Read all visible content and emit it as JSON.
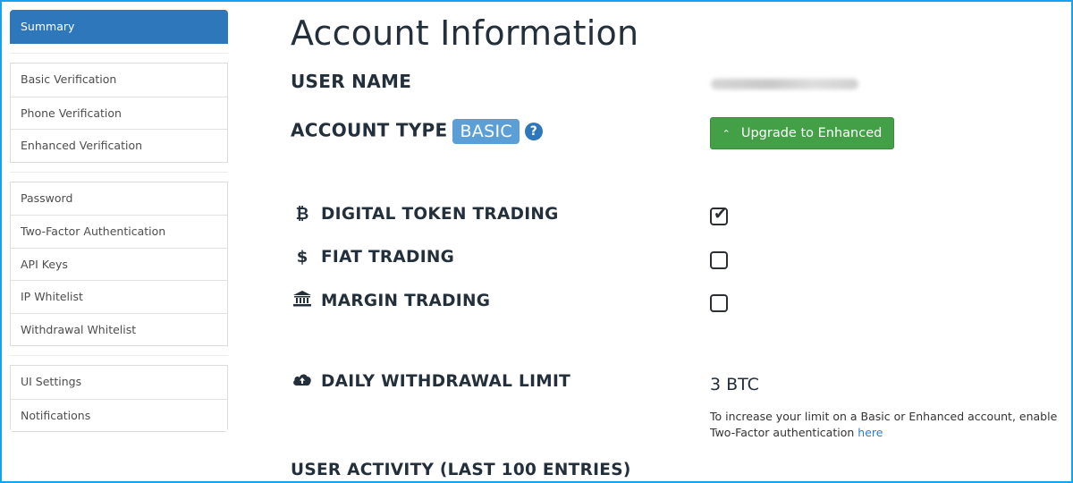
{
  "sidebar": {
    "active": {
      "label": "Summary",
      "color": "#2e77bb"
    },
    "groups": [
      {
        "items": [
          {
            "label": "Basic Verification"
          },
          {
            "label": "Phone Verification"
          },
          {
            "label": "Enhanced Verification"
          }
        ]
      },
      {
        "items": [
          {
            "label": "Password"
          },
          {
            "label": "Two-Factor Authentication"
          },
          {
            "label": "API Keys"
          },
          {
            "label": "IP Whitelist"
          },
          {
            "label": "Withdrawal Whitelist"
          }
        ]
      },
      {
        "items": [
          {
            "label": "UI Settings"
          },
          {
            "label": "Notifications"
          }
        ]
      }
    ]
  },
  "main": {
    "title": "Account Information",
    "user_name": {
      "label": "USER NAME",
      "value_hidden": true
    },
    "account_type": {
      "label": "ACCOUNT TYPE",
      "badge": "BASIC",
      "badge_color": "#5b9fd6",
      "help_icon": "question-circle-icon"
    },
    "upgrade_button": {
      "label": "Upgrade to Enhanced",
      "icon": "double-chevron-up-icon",
      "color": "#43a047"
    },
    "permissions": [
      {
        "icon": "bitcoin-icon",
        "glyph": "₿",
        "label": "DIGITAL TOKEN TRADING",
        "checked": true
      },
      {
        "icon": "dollar-icon",
        "glyph": "$",
        "label": "FIAT TRADING",
        "checked": false
      },
      {
        "icon": "bank-icon",
        "glyph": "🏛",
        "label": "MARGIN TRADING",
        "checked": false
      }
    ],
    "withdrawal": {
      "icon": "cloud-upload-icon",
      "label": "DAILY WITHDRAWAL LIMIT",
      "value": "3 BTC",
      "note_text": "To increase your limit on a Basic or Enhanced account, enable Two-Factor authentication ",
      "note_link": "here"
    },
    "activity_heading": "USER ACTIVITY (LAST 100 ENTRIES)"
  }
}
